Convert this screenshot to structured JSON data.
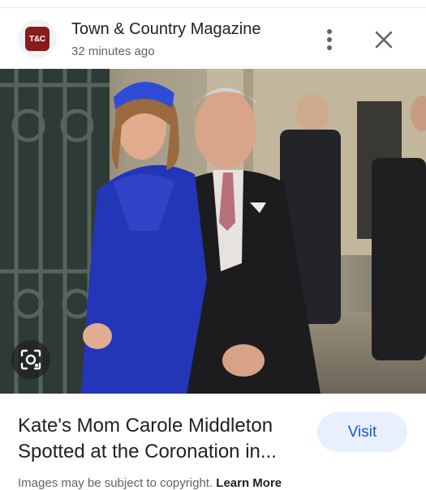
{
  "header": {
    "logo_text": "T&C",
    "source_name": "Town & Country Magazine",
    "time_ago": "32 minutes ago",
    "menu_icon": "more-vert-icon",
    "close_icon": "close-icon"
  },
  "image": {
    "description_icon": "lens-icon"
  },
  "article": {
    "title": "Kate's Mom Carole Middleton Spotted at the Coronation in...",
    "visit_label": "Visit"
  },
  "footer": {
    "disclaimer": "Images may be subject to copyright.",
    "learn_more": "Learn More"
  },
  "colors": {
    "brand": "#8b1a1a",
    "visit_bg": "#e8f0fe",
    "visit_text": "#1a57c4"
  }
}
